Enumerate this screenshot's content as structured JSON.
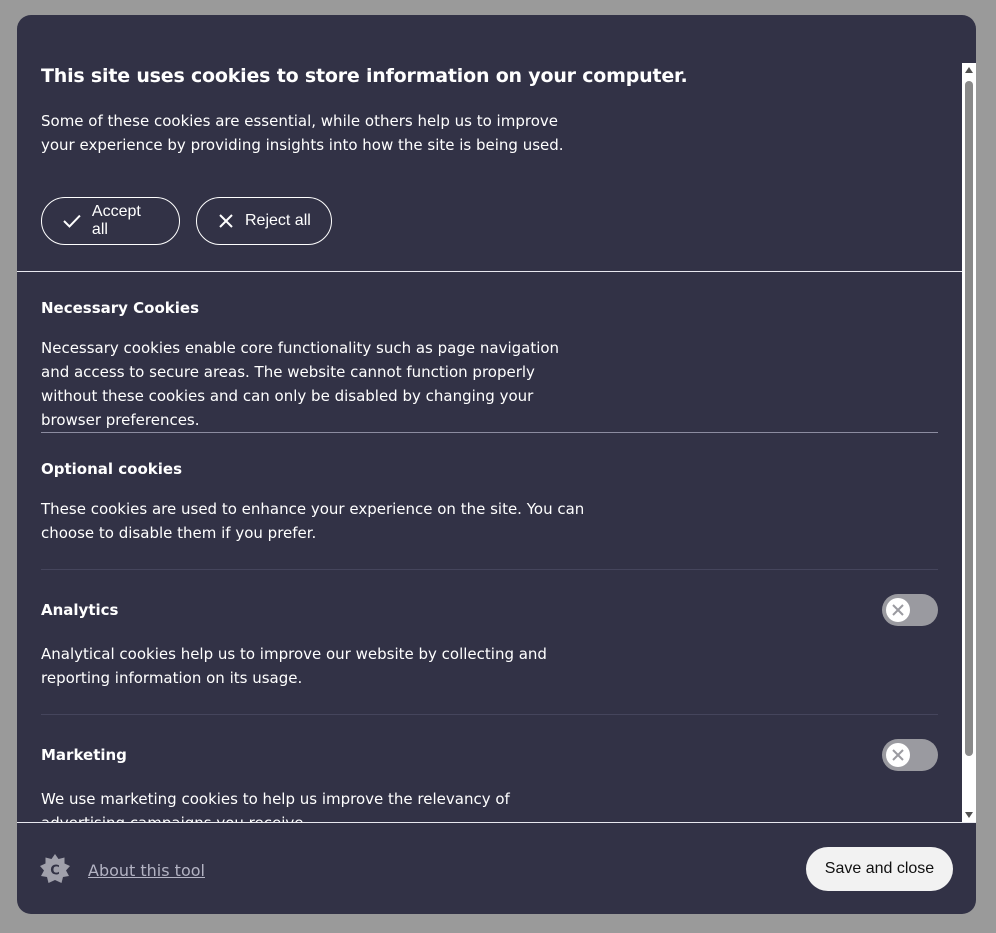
{
  "header": {
    "title": "This site uses cookies to store information on your computer.",
    "intro": "Some of these cookies are essential, while others help us to improve your experience by providing insights into how the site is being used."
  },
  "actions": {
    "accept_all": "Accept all",
    "reject_all": "Reject all"
  },
  "sections": {
    "necessary": {
      "heading": "Necessary Cookies",
      "body": "Necessary cookies enable core functionality such as page navigation and access to secure areas. The website cannot function properly without these cookies and can only be disabled by changing your browser preferences."
    },
    "optional": {
      "heading": "Optional cookies",
      "body": "These cookies are used to enhance your experience on the site. You can choose to disable them if you prefer."
    },
    "analytics": {
      "heading": "Analytics",
      "body": "Analytical cookies help us to improve our website by collecting and reporting information on its usage.",
      "enabled": false
    },
    "marketing": {
      "heading": "Marketing",
      "body": "We use marketing cookies to help us improve the relevancy of advertising campaigns you receive.",
      "enabled": false
    }
  },
  "footer": {
    "logo_icon": "civic-cookie-control-logo-icon",
    "about_link": "About this tool",
    "save_button": "Save and close"
  },
  "colors": {
    "backdrop": "#9a9a9a",
    "panel": "#323246",
    "text": "#ffffff",
    "toggle_off": "#9a9aa0",
    "link": "#b3b3c3"
  }
}
